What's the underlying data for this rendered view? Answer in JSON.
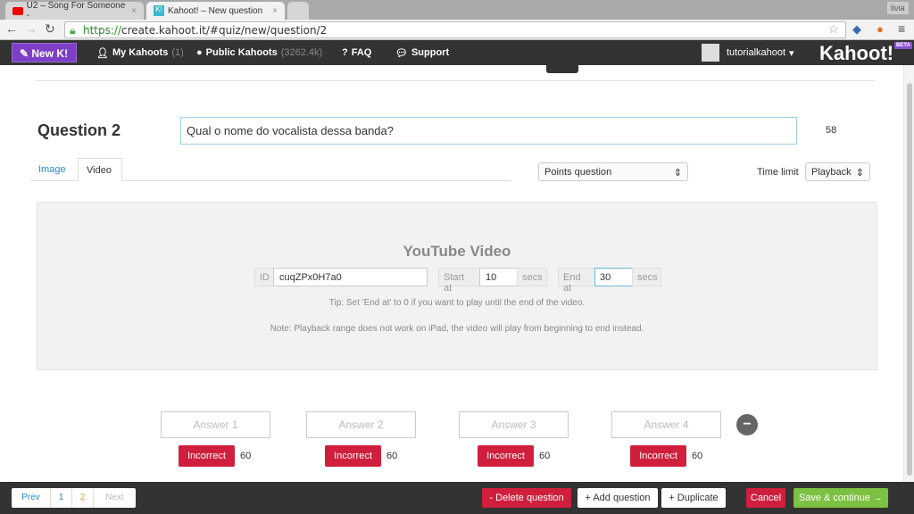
{
  "browser": {
    "tabs": [
      {
        "label": "U2 – Song For Someone -",
        "icon": "youtube-icon"
      },
      {
        "label": "Kahoot! – New question",
        "icon": "kahoot-icon"
      }
    ],
    "user": "livia",
    "url_scheme": "https://",
    "url_rest": "create.kahoot.it/#quiz/new/question/2"
  },
  "nav": {
    "new_label": "New K!",
    "my_kahoots": "My Kahoots",
    "my_count": "(1)",
    "public_kahoots": "Public Kahoots",
    "public_count": "(3262.4k)",
    "faq": "FAQ",
    "support": "Support",
    "username": "tutorialkahoot",
    "logo": "Kahoot!",
    "beta": "BETA"
  },
  "question": {
    "title": "Question 2",
    "text": "Qual o nome do vocalista dessa banda?",
    "chars_left": "58",
    "tabs": [
      "Image",
      "Video"
    ],
    "points": "Points question",
    "time_limit_label": "Time limit",
    "time_limit": "Playback"
  },
  "video": {
    "title": "YouTube Video",
    "id_label": "ID",
    "id": "cuqZPx0H7a0",
    "start_label": "Start at",
    "start": "10",
    "end_label": "End at",
    "end": "30",
    "secs": "secs",
    "tip": "Tip: Set 'End at' to 0 if you want to play until the end of the video.",
    "note": "Note: Playback range does not work on iPad, the video will play from beginning to end instead."
  },
  "answers": [
    {
      "placeholder": "Answer 1",
      "status": "Incorrect",
      "time": "60"
    },
    {
      "placeholder": "Answer 2",
      "status": "Incorrect",
      "time": "60"
    },
    {
      "placeholder": "Answer 3",
      "status": "Incorrect",
      "time": "60"
    },
    {
      "placeholder": "Answer 4",
      "status": "Incorrect",
      "time": "60"
    }
  ],
  "footer": {
    "prev": "Prev",
    "pages": [
      "1",
      "2"
    ],
    "next": "Next",
    "delete": "- Delete question",
    "add": "+ Add question",
    "duplicate": "+ Duplicate",
    "cancel": "Cancel",
    "save": "Save & continue →"
  },
  "colors": {
    "purple": "#7e3fc6",
    "red": "#cf1f3c",
    "green": "#7cc142",
    "dark": "#333333"
  }
}
